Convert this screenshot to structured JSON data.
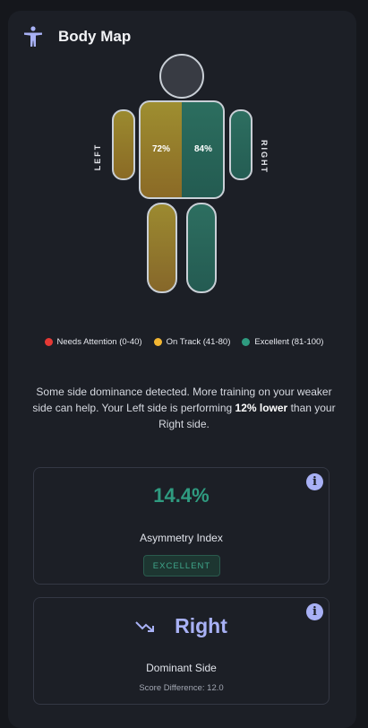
{
  "header": {
    "title": "Body Map",
    "icon": "accessibility-icon"
  },
  "body_map": {
    "left_label": "LEFT",
    "right_label": "RIGHT",
    "left_pct": "72%",
    "right_pct": "84%",
    "colors": {
      "on_track": "#9b8a2f",
      "excellent": "#2d6e60"
    }
  },
  "legend": [
    {
      "label": "Needs Attention (0-40)",
      "color": "#e53935"
    },
    {
      "label": "On Track (41-80)",
      "color": "#f2b632"
    },
    {
      "label": "Excellent (81-100)",
      "color": "#2f9b80"
    }
  ],
  "summary": {
    "text_before": "Some side dominance detected. More training on your weaker side can help. Your Left side is performing ",
    "emphasis": "12% lower",
    "text_after": " than your Right side."
  },
  "asymmetry": {
    "value": "14.4%",
    "label": "Asymmetry Index",
    "badge": "EXCELLENT",
    "info_icon": "info-icon"
  },
  "dominant": {
    "value": "Right",
    "label": "Dominant Side",
    "score_diff": "Score Difference: 12.0",
    "trend_icon": "trending-down-icon",
    "info_icon": "info-icon"
  }
}
